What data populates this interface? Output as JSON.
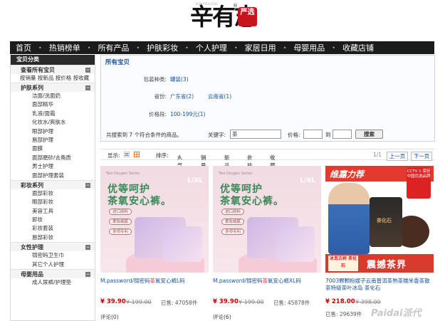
{
  "brand": {
    "logo_text": "辛有志",
    "seal_text": "严选",
    "reg_mark": "®",
    "tiny_text": "XINYOUZHI"
  },
  "nav": [
    "首页",
    "热销榜单",
    "所有产品",
    "护肤彩妆",
    "个人护理",
    "家居日用",
    "母婴用品",
    "收藏店铺"
  ],
  "nav_sep": "•",
  "sidebar": {
    "title": "宝贝分类",
    "view_all": "查看所有宝贝",
    "sort_links": "按销量 按新品 按价格 按收藏",
    "categories": [
      {
        "name": "护肤系列",
        "toggle": "−",
        "items": [
          "洁面/洗面奶",
          "面部精华",
          "乳液/面霜",
          "化妆水/爽肤水",
          "眼部护理",
          "唇部护理",
          "面膜",
          "面部磨砂/去角质",
          "男士护理",
          "面部护理套装"
        ]
      },
      {
        "name": "彩妆系列",
        "toggle": "−",
        "items": [
          "面部彩妆",
          "眼部彩妆",
          "美容工具",
          "卸妆",
          "彩妆套装",
          "唇部彩妆"
        ]
      },
      {
        "name": "女性护理",
        "toggle": "−",
        "items": [
          "锦密码卫生巾",
          "其它个人护理"
        ]
      },
      {
        "name": "母婴用品",
        "toggle": "−",
        "items": [
          "成人尿裤/护理垫"
        ]
      }
    ]
  },
  "filter": {
    "title": "所有宝贝",
    "rows": [
      {
        "label": "包装种类:",
        "values": [
          "罐装(3)"
        ]
      },
      {
        "label": "省份:",
        "values": [
          "广东省(2)",
          "云南省(1)"
        ]
      },
      {
        "label": "价格段:",
        "values": [
          "100-199元(1)"
        ]
      }
    ],
    "result_text": "共搜索到 7 个符合条件的商品。",
    "keyword_label": "关键字:",
    "keyword_value": "茶",
    "price_label": "价格:",
    "price_to": "到",
    "search_btn": "搜索"
  },
  "toolbar": {
    "display_label": "显示:",
    "sort_label": "排序:",
    "sorts": [
      "人气",
      "销量",
      "新品",
      "价格",
      "收藏"
    ],
    "page_info": "1/1",
    "prev": "上一页",
    "next": "下一页"
  },
  "products": [
    {
      "name_pre": "M.password/锦密码",
      "name_hl": "茶",
      "name_post": "氧安心裤L码",
      "price": "¥ 39.90",
      "old_price": "¥ 199.00",
      "sold": "已售: 47058件",
      "comments": "评论(0)",
      "img": {
        "brand": "Two Oxygen Series",
        "size": "L/XL",
        "line1": "优等呵护",
        "line2": "茶氧安心裤。",
        "pills": [
          "进口原料",
          "柔软细腻",
          "多项专利"
        ]
      }
    },
    {
      "name_pre": "M.password/锦密码",
      "name_hl": "茶",
      "name_post": "氧安心裤XL码",
      "price": "¥ 39.90",
      "old_price": "¥ 199.00",
      "sold": "已售: 45878件",
      "comments": "评论(6)",
      "img": {
        "brand": "Two Oxygen Series",
        "size": "L/XL",
        "line1": "优等呵护",
        "line2": "茶氧安心裤。",
        "pills": [
          "进口原料",
          "柔软细腻",
          "多项专利"
        ]
      }
    },
    {
      "name_line1": "7003颗颗粉嫂子云南普洱茶熟茶糯米香茶散",
      "name_line2": "茶特级茶叶冰岛 茶化石",
      "price": "¥ 218.00",
      "old_price": "¥ 398.00",
      "sold": "已售: 29639件",
      "img": {
        "banner": "维嘉力荐",
        "cctv": "CCTV 1 荣获中国优选品牌",
        "jar_text": "茶化石",
        "tag": "冰岛古树 茶化石",
        "slogan": "震撼茶界"
      }
    }
  ],
  "watermark": "Paidai派代"
}
